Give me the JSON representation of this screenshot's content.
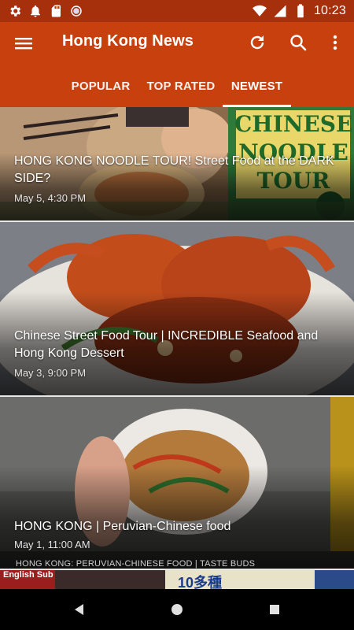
{
  "status_bar": {
    "time": "10:23",
    "left_icons": [
      "gear-icon",
      "bell-icon",
      "sd-card-icon",
      "sync-dot-icon"
    ],
    "right_icons": [
      "wifi-icon",
      "cell-signal-icon",
      "battery-icon"
    ]
  },
  "app_bar": {
    "title": "Hong Kong News",
    "actions": [
      "refresh-icon",
      "search-icon",
      "overflow-menu-icon"
    ],
    "background": "#c8400e"
  },
  "tabs": [
    {
      "label": "POPULAR",
      "active": false
    },
    {
      "label": "TOP RATED",
      "active": false
    },
    {
      "label": "NEWEST",
      "active": true
    }
  ],
  "articles": [
    {
      "title": "HONG KONG NOODLE TOUR! Street Food at the DARK SIDE?",
      "date": "May 5, 4:30 PM"
    },
    {
      "title": "Chinese Street Food Tour | INCREDIBLE Seafood and Hong Kong Dessert",
      "date": "May 3, 9:00 PM"
    },
    {
      "title": "HONG KONG | Peruvian-Chinese food",
      "date": "May 1, 11:00 AM"
    }
  ],
  "thumbnail_texts": {
    "noodle_tour": "CHINESE NOODLE TOUR",
    "peruvian_caption": "HONG KONG: PERUVIAN-CHINESE FOOD | TASTE BUDS",
    "english_sub": "English Sub",
    "sign_text": "10多種"
  },
  "nav_bar": [
    "back-icon",
    "home-icon",
    "recents-icon"
  ]
}
